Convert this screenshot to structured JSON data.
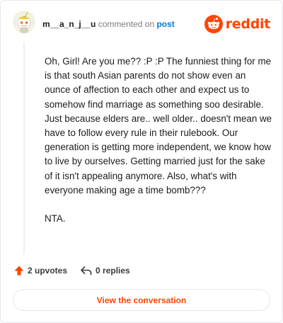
{
  "header": {
    "username": "m__a_n_j__u",
    "action_text": "commented on",
    "target_link": "post",
    "brand_name": "reddit"
  },
  "comment": {
    "paragraphs": [
      "Oh, Girl! Are you me?? :P :P The funniest thing for me is that south Asian parents do not show even an ounce of affection to each other and expect us to somehow find marriage as something soo desirable. Just because elders are.. well older.. doesn't mean we have to follow every rule in their rulebook. Our generation is getting more independent, we know how to live by ourselves. Getting married just for the sake of it isn't appealing anymore. Also, what's with everyone making age a time bomb???",
      "NTA."
    ]
  },
  "footer": {
    "upvotes_label": "2 upvotes",
    "replies_label": "0 replies",
    "cta_label": "View the conversation"
  },
  "colors": {
    "brand": "#ff4500",
    "link": "#0079d3",
    "muted": "#7c7c7c"
  },
  "icons": {
    "avatar": "snoo-avatar-icon",
    "brand": "reddit-logo-icon",
    "upvote": "upvote-arrow-icon",
    "reply": "reply-arrow-icon"
  }
}
